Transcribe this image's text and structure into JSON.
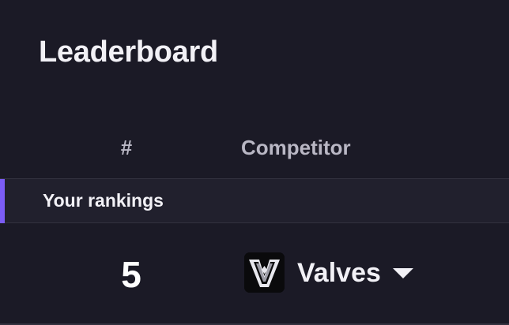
{
  "page": {
    "title": "Leaderboard"
  },
  "table": {
    "columns": {
      "rank": "#",
      "competitor": "Competitor"
    },
    "section_label": "Your rankings",
    "rows": [
      {
        "rank": "5",
        "competitor": "Valves",
        "avatar_icon": "valves-team-logo-icon"
      }
    ]
  },
  "colors": {
    "background": "#1b1a26",
    "section_band": "#21202d",
    "accent": "#7b5cf5",
    "header_text": "#b9b7c4"
  }
}
